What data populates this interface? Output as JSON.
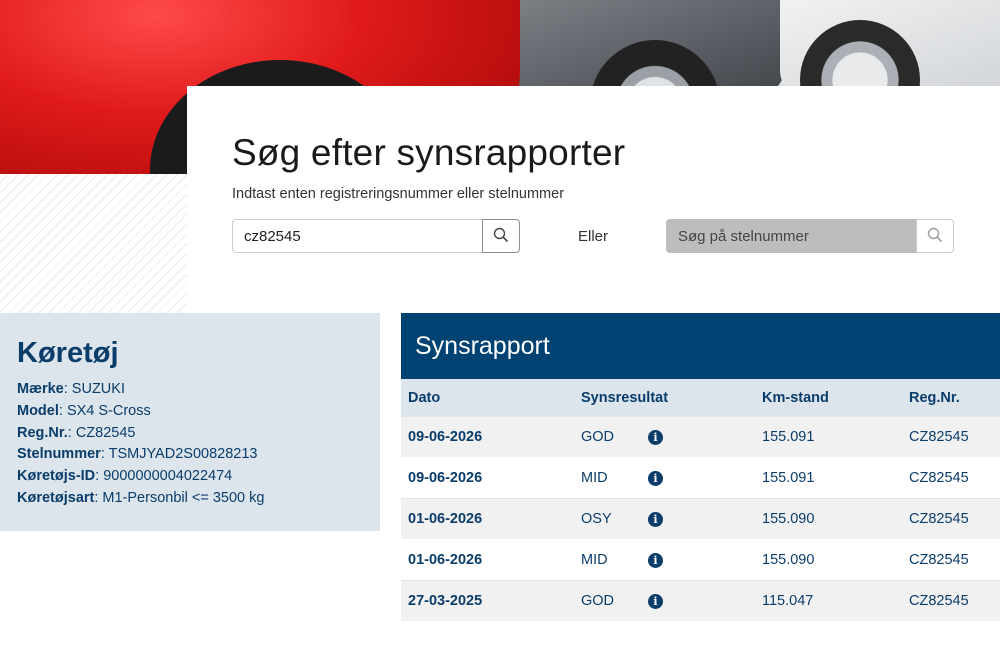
{
  "search": {
    "title": "Søg efter synsrapporter",
    "subtitle": "Indtast enten registreringsnummer eller stelnummer",
    "reg_value": "cz82545",
    "or_label": "Eller",
    "vin_placeholder": "Søg på stelnummer"
  },
  "vehicle": {
    "heading": "Køretøj",
    "fields": [
      {
        "label": "Mærke",
        "value": ": SUZUKI"
      },
      {
        "label": "Model",
        "value": ": SX4 S-Cross"
      },
      {
        "label": "Reg.Nr.",
        "value": ": CZ82545"
      },
      {
        "label": "Stelnummer",
        "value": ": TSMJYAD2S00828213"
      },
      {
        "label": "Køretøjs-ID",
        "value": ": 9000000004022474"
      },
      {
        "label": "Køretøjsart",
        "value": ": M1-Personbil <= 3500 kg"
      }
    ]
  },
  "report": {
    "heading": "Synsrapport",
    "columns": [
      "Dato",
      "Synsresultat",
      "Km-stand",
      "Reg.Nr."
    ],
    "rows": [
      {
        "date": "09-06-2026",
        "result": "GOD",
        "km": "155.091",
        "reg": "CZ82545"
      },
      {
        "date": "09-06-2026",
        "result": "MID",
        "km": "155.091",
        "reg": "CZ82545"
      },
      {
        "date": "01-06-2026",
        "result": "OSY",
        "km": "155.090",
        "reg": "CZ82545"
      },
      {
        "date": "01-06-2026",
        "result": "MID",
        "km": "155.090",
        "reg": "CZ82545"
      },
      {
        "date": "27-03-2025",
        "result": "GOD",
        "km": "115.047",
        "reg": "CZ82545"
      }
    ],
    "info_icon": "i"
  },
  "icons": {
    "search": "search-icon",
    "info": "info-icon"
  },
  "colors": {
    "brand_dark": "#004272",
    "text_blue": "#0b3d6b",
    "panel_bg": "#dce4ec"
  }
}
